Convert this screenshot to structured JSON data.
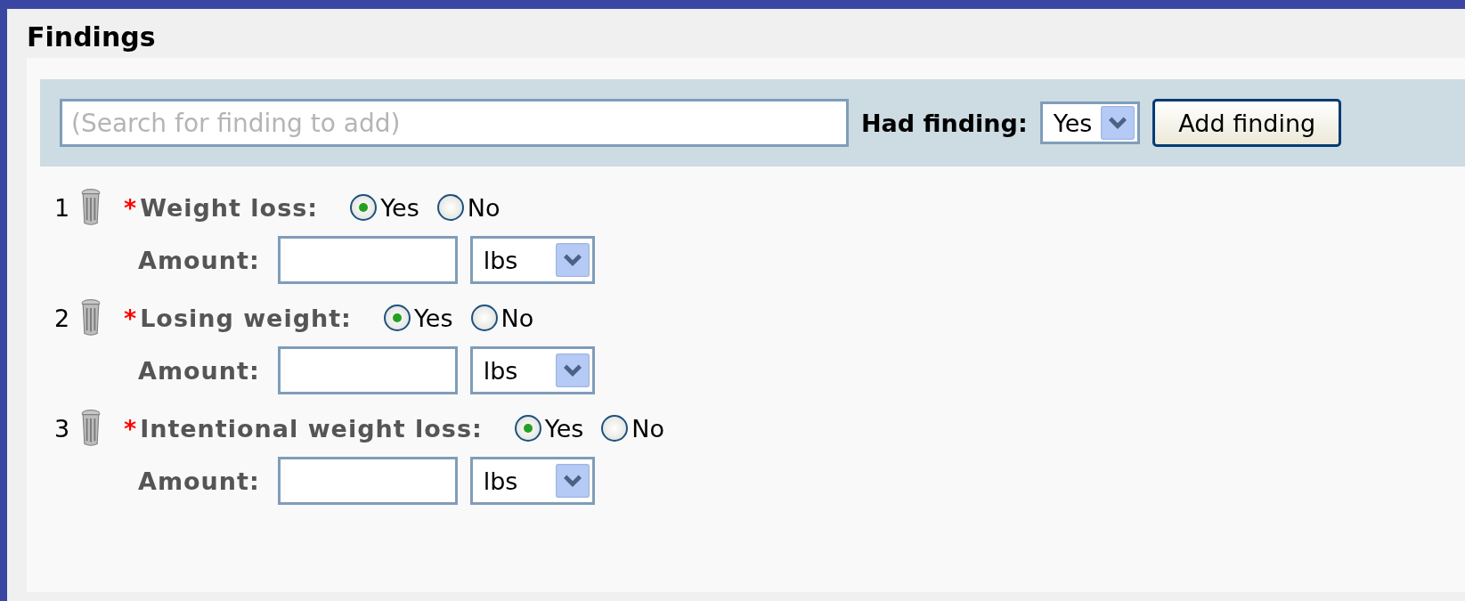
{
  "section": {
    "title": "Findings"
  },
  "search": {
    "placeholder": "(Search for finding to add)",
    "had_label": "Had finding:",
    "had_value": "Yes",
    "add_button": "Add finding"
  },
  "findings": [
    {
      "number": "1",
      "required": true,
      "required_mark": "*",
      "label": "Weight loss:",
      "options": [
        {
          "label": "Yes",
          "selected": true
        },
        {
          "label": "No",
          "selected": false
        }
      ],
      "amount_label": "Amount:",
      "unit": "lbs"
    },
    {
      "number": "2",
      "required": true,
      "required_mark": "*",
      "label": "Losing weight:",
      "options": [
        {
          "label": "Yes",
          "selected": true
        },
        {
          "label": "No",
          "selected": false
        }
      ],
      "amount_label": "Amount:",
      "unit": "lbs"
    },
    {
      "number": "3",
      "required": true,
      "required_mark": "*",
      "label": "Intentional weight loss:",
      "options": [
        {
          "label": "Yes",
          "selected": true
        },
        {
          "label": "No",
          "selected": false
        }
      ],
      "amount_label": "Amount:",
      "unit": "lbs"
    }
  ]
}
